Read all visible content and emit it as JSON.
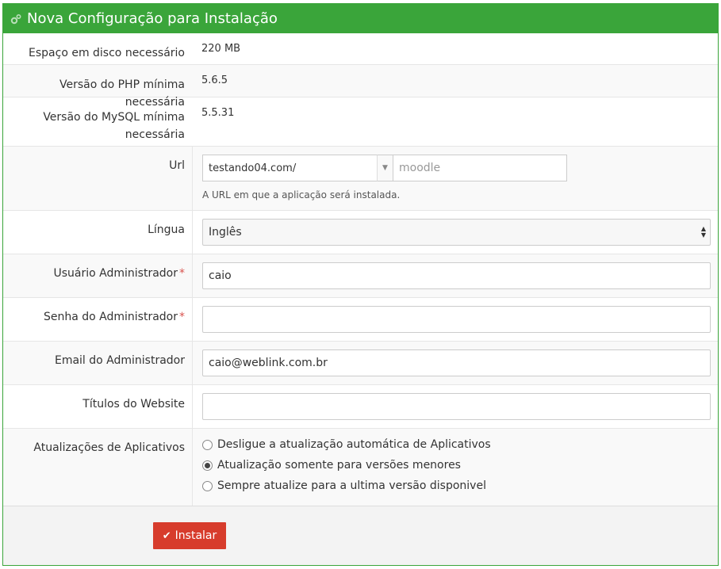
{
  "header": {
    "title": "Nova Configuração para Instalação",
    "icon": "gears-icon"
  },
  "info": [
    {
      "label": "Espaço em disco necessário",
      "value": "220 MB"
    },
    {
      "label": "Versão do PHP mínima necessária",
      "value": "5.6.5"
    },
    {
      "label": "Versão do MySQL mínima necessária",
      "value": "5.5.31"
    }
  ],
  "url": {
    "label": "Url",
    "domain": "testando04.com/",
    "path_placeholder": "moodle",
    "help": "A URL em que a aplicação será instalada."
  },
  "language": {
    "label": "Língua",
    "selected": "Inglês"
  },
  "admin_user": {
    "label": "Usuário Administrador",
    "value": "caio",
    "required_mark": "*"
  },
  "admin_password": {
    "label": "Senha do Administrador",
    "value": "",
    "required_mark": "*"
  },
  "admin_email": {
    "label": "Email do Administrador",
    "value": "caio@weblink.com.br"
  },
  "site_title": {
    "label": "Títulos do Website",
    "value": ""
  },
  "updates": {
    "label": "Atualizações de Aplicativos",
    "options": [
      {
        "label": "Desligue a atualização automática de Aplicativos",
        "checked": false
      },
      {
        "label": "Atualização somente para versões menores",
        "checked": true
      },
      {
        "label": "Sempre atualize para a ultima versão disponivel",
        "checked": false
      }
    ]
  },
  "install_button": {
    "label": "Instalar",
    "icon": "check-icon"
  },
  "colors": {
    "header": "#3aa53a",
    "button": "#d73c2c",
    "required": "#d9534f"
  }
}
